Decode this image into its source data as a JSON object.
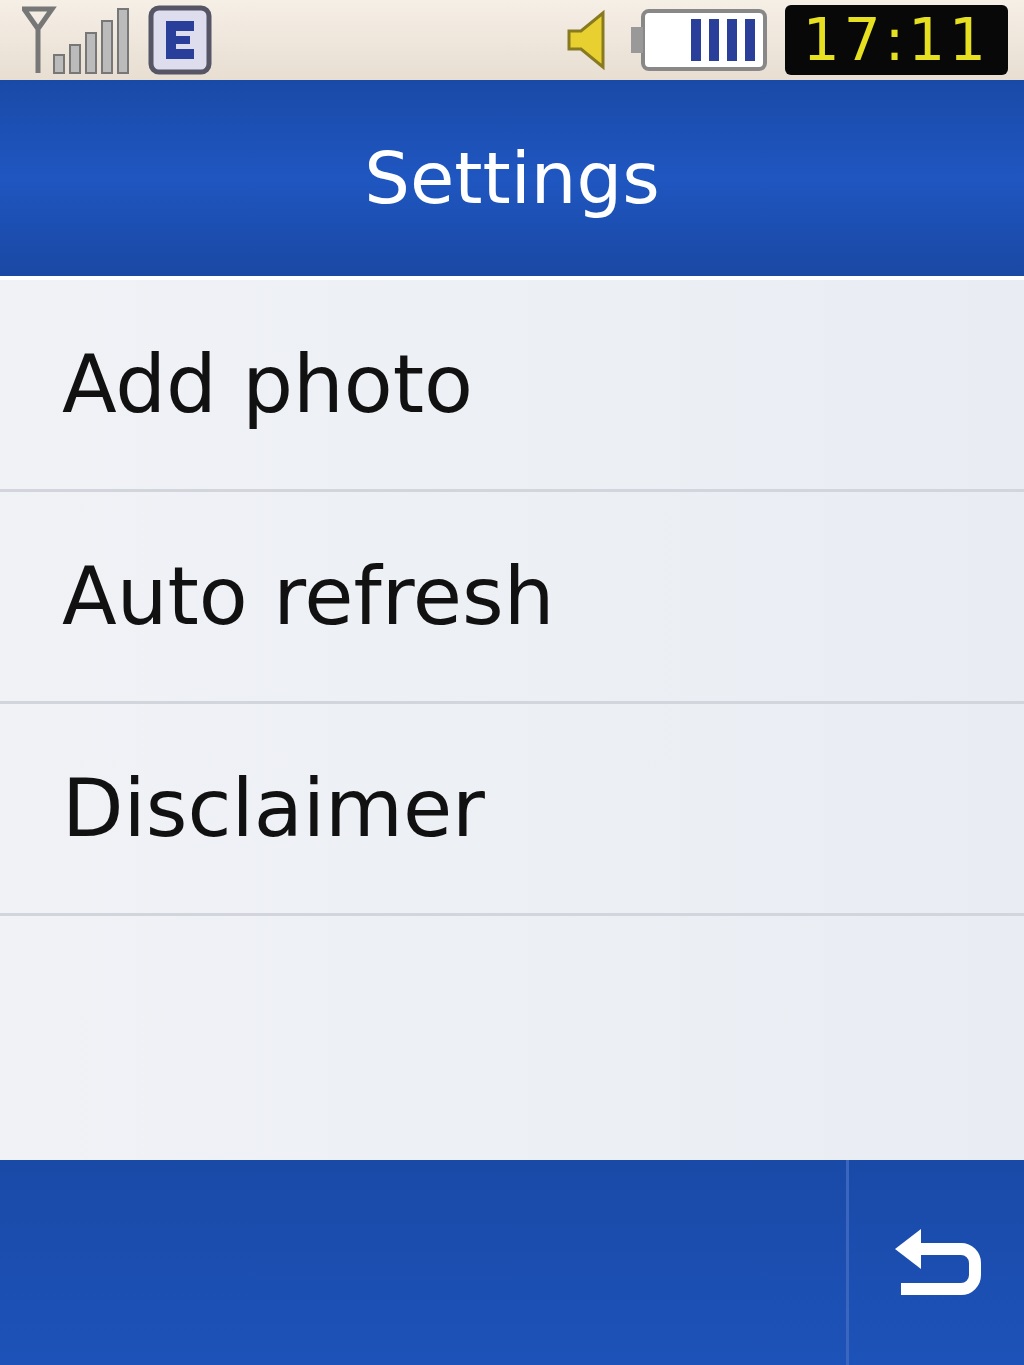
{
  "status_bar": {
    "time": "17:11"
  },
  "header": {
    "title": "Settings"
  },
  "menu": {
    "items": [
      {
        "label": "Add photo"
      },
      {
        "label": "Auto refresh"
      },
      {
        "label": "Disclaimer"
      }
    ]
  }
}
